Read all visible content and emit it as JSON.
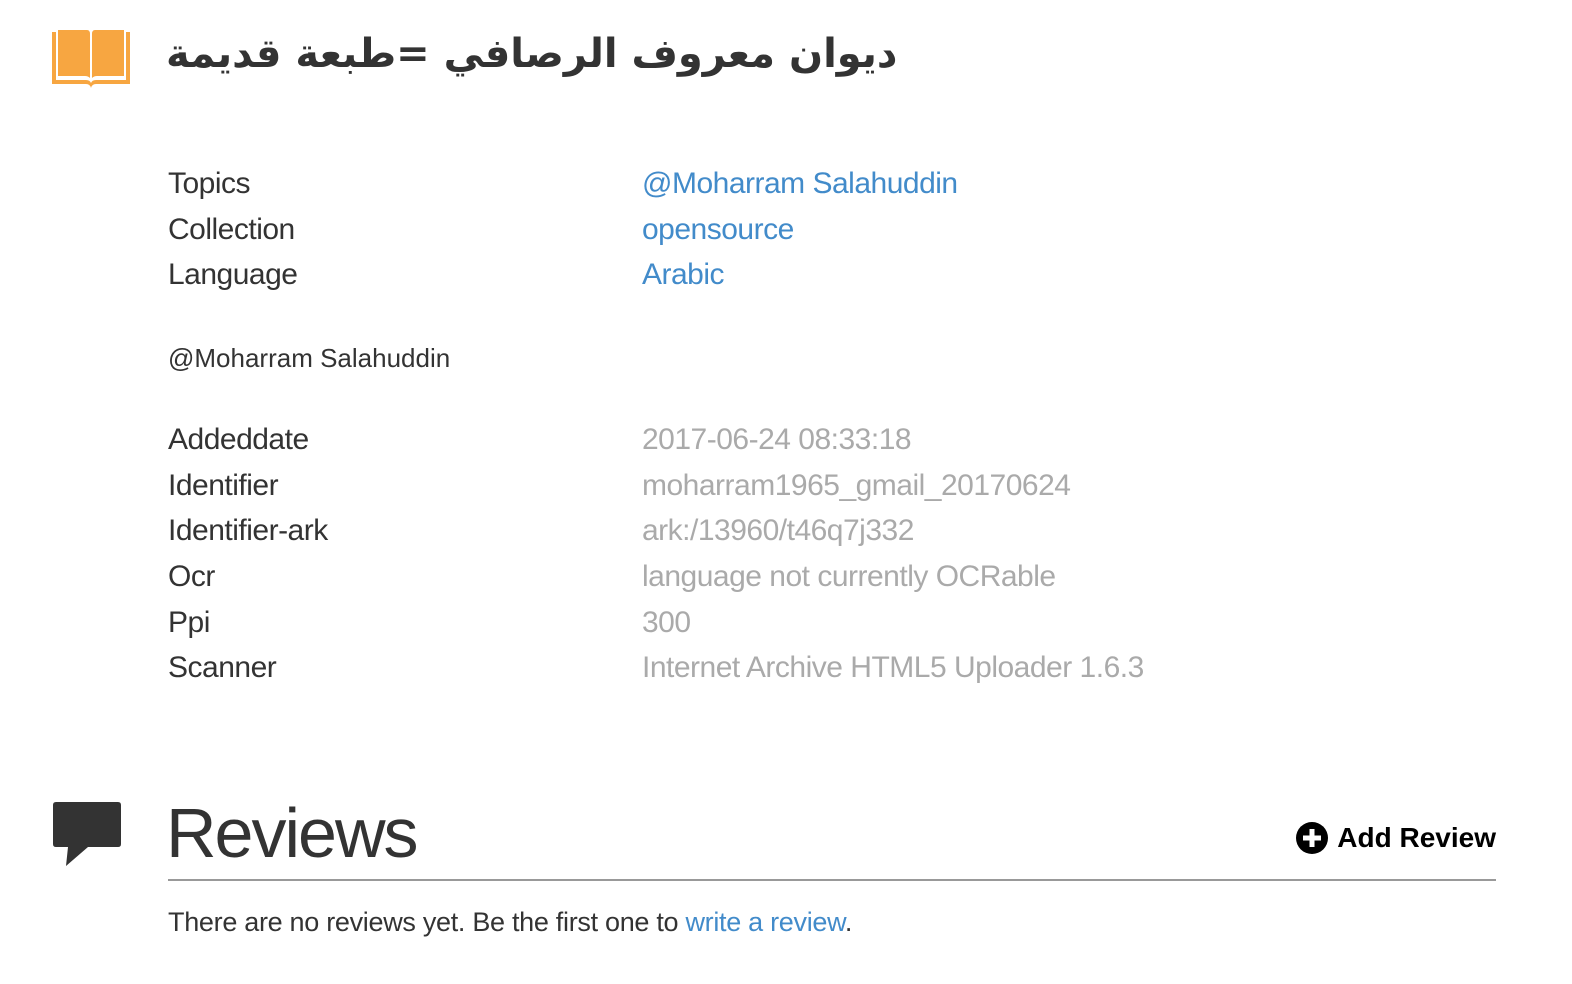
{
  "item": {
    "title": "ديوان معروف الرصافي =طبعة قديمة",
    "icon": "book-icon",
    "icon_color": "#f7a641"
  },
  "metadata_primary": [
    {
      "label": "Topics",
      "value": "@Moharram Salahuddin",
      "is_link": true
    },
    {
      "label": "Collection",
      "value": "opensource",
      "is_link": true
    },
    {
      "label": "Language",
      "value": "Arabic",
      "is_link": true
    }
  ],
  "description": "@Moharram Salahuddin",
  "metadata_secondary": [
    {
      "label": "Addeddate",
      "value": "2017-06-24 08:33:18"
    },
    {
      "label": "Identifier",
      "value": "moharram1965_gmail_20170624"
    },
    {
      "label": "Identifier-ark",
      "value": "ark:/13960/t46q7j332"
    },
    {
      "label": "Ocr",
      "value": "language not currently OCRable"
    },
    {
      "label": "Ppi",
      "value": "300"
    },
    {
      "label": "Scanner",
      "value": "Internet Archive HTML5 Uploader 1.6.3"
    }
  ],
  "reviews": {
    "heading": "Reviews",
    "icon": "speech-bubble-icon",
    "add_label": "Add Review",
    "add_icon": "plus-circle-icon",
    "empty_prefix": "There are no reviews yet. Be the first one to ",
    "empty_link": "write a review",
    "empty_suffix": "."
  },
  "colors": {
    "link": "#428bca",
    "muted": "#aaaaaa",
    "text": "#333333",
    "accent": "#f7a641"
  }
}
